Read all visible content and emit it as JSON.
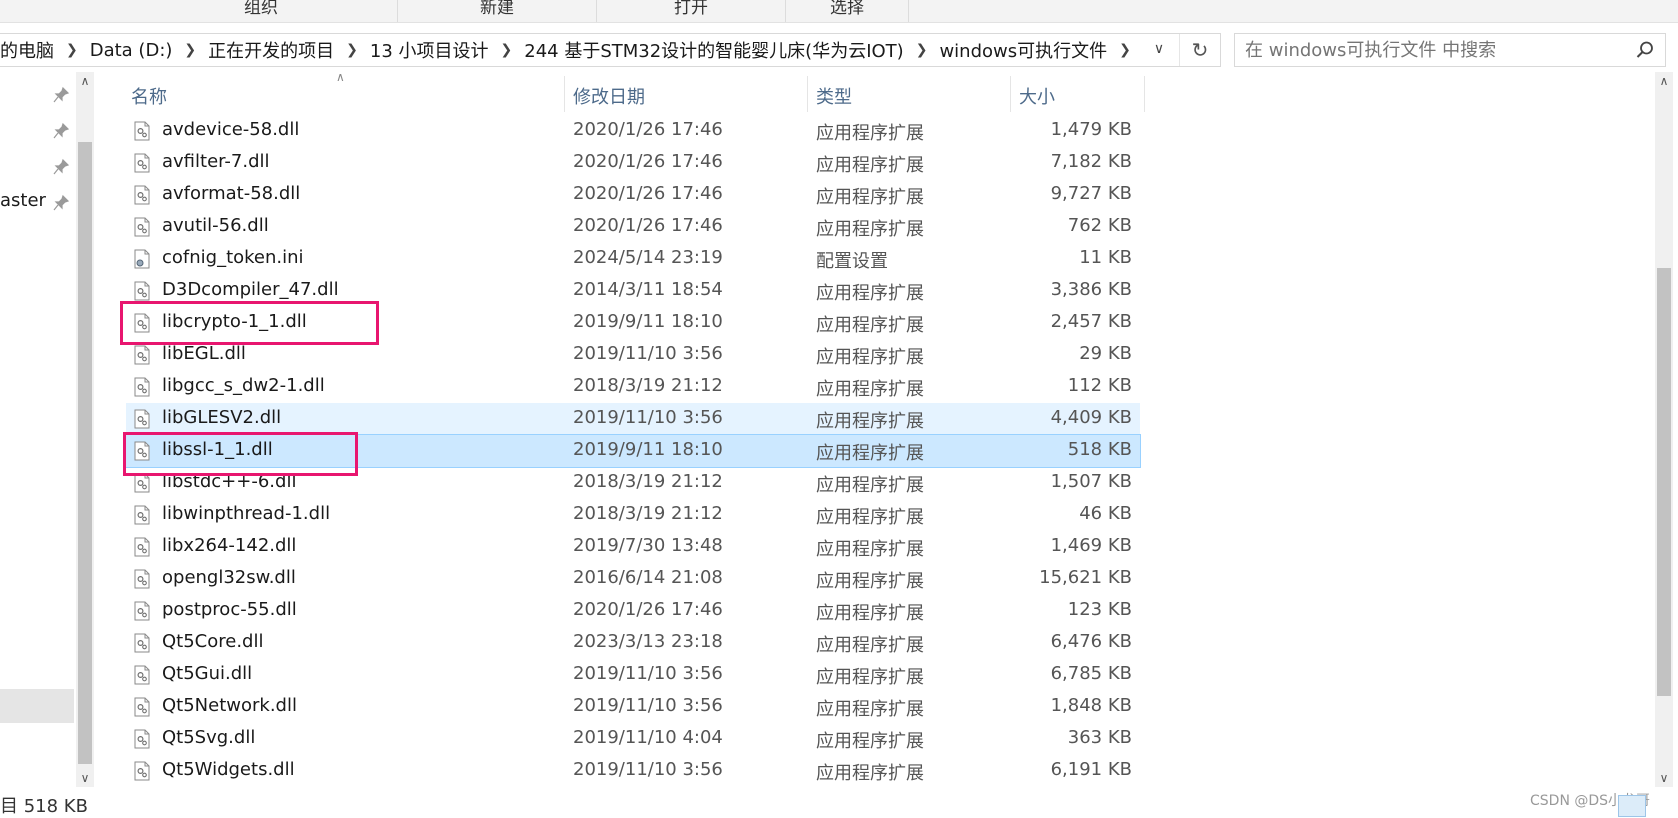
{
  "ribbon": {
    "groups": [
      "组织",
      "新建",
      "打开",
      "选择"
    ]
  },
  "address": {
    "crumbs": [
      "的电脑",
      "Data (D:)",
      "正在开发的项目",
      "13 小项目设计",
      "244 基于STM32设计的智能婴儿床(华为云IOT)",
      "windows可执行文件"
    ]
  },
  "search": {
    "placeholder": "在 windows可执行文件 中搜索"
  },
  "nav": {
    "partial_label": "aster"
  },
  "columns": {
    "name": "名称",
    "date": "修改日期",
    "type": "类型",
    "size": "大小"
  },
  "files": [
    {
      "name": "avdevice-58.dll",
      "date": "2020/1/26 17:46",
      "type": "应用程序扩展",
      "size": "1,479 KB"
    },
    {
      "name": "avfilter-7.dll",
      "date": "2020/1/26 17:46",
      "type": "应用程序扩展",
      "size": "7,182 KB"
    },
    {
      "name": "avformat-58.dll",
      "date": "2020/1/26 17:46",
      "type": "应用程序扩展",
      "size": "9,727 KB"
    },
    {
      "name": "avutil-56.dll",
      "date": "2020/1/26 17:46",
      "type": "应用程序扩展",
      "size": "762 KB"
    },
    {
      "name": "cofnig_token.ini",
      "date": "2024/5/14 23:19",
      "type": "配置设置",
      "size": "11 KB"
    },
    {
      "name": "D3Dcompiler_47.dll",
      "date": "2014/3/11 18:54",
      "type": "应用程序扩展",
      "size": "3,386 KB"
    },
    {
      "name": "libcrypto-1_1.dll",
      "date": "2019/9/11 18:10",
      "type": "应用程序扩展",
      "size": "2,457 KB"
    },
    {
      "name": "libEGL.dll",
      "date": "2019/11/10 3:56",
      "type": "应用程序扩展",
      "size": "29 KB"
    },
    {
      "name": "libgcc_s_dw2-1.dll",
      "date": "2018/3/19 21:12",
      "type": "应用程序扩展",
      "size": "112 KB"
    },
    {
      "name": "libGLESV2.dll",
      "date": "2019/11/10 3:56",
      "type": "应用程序扩展",
      "size": "4,409 KB"
    },
    {
      "name": "libssl-1_1.dll",
      "date": "2019/9/11 18:10",
      "type": "应用程序扩展",
      "size": "518 KB"
    },
    {
      "name": "libstdc++-6.dll",
      "date": "2018/3/19 21:12",
      "type": "应用程序扩展",
      "size": "1,507 KB"
    },
    {
      "name": "libwinpthread-1.dll",
      "date": "2018/3/19 21:12",
      "type": "应用程序扩展",
      "size": "46 KB"
    },
    {
      "name": "libx264-142.dll",
      "date": "2019/7/30 13:48",
      "type": "应用程序扩展",
      "size": "1,469 KB"
    },
    {
      "name": "opengl32sw.dll",
      "date": "2016/6/14 21:08",
      "type": "应用程序扩展",
      "size": "15,621 KB"
    },
    {
      "name": "postproc-55.dll",
      "date": "2020/1/26 17:46",
      "type": "应用程序扩展",
      "size": "123 KB"
    },
    {
      "name": "Qt5Core.dll",
      "date": "2023/3/13 23:18",
      "type": "应用程序扩展",
      "size": "6,476 KB"
    },
    {
      "name": "Qt5Gui.dll",
      "date": "2019/11/10 3:56",
      "type": "应用程序扩展",
      "size": "6,785 KB"
    },
    {
      "name": "Qt5Network.dll",
      "date": "2019/11/10 3:56",
      "type": "应用程序扩展",
      "size": "1,848 KB"
    },
    {
      "name": "Qt5Svg.dll",
      "date": "2019/11/10 4:04",
      "type": "应用程序扩展",
      "size": "363 KB"
    },
    {
      "name": "Qt5Widgets.dll",
      "date": "2019/11/10 3:56",
      "type": "应用程序扩展",
      "size": "6,191 KB"
    }
  ],
  "hover_index": 9,
  "selected_index": 10,
  "highlight_color": "#e8166f",
  "status": {
    "selected_size": "目 518 KB"
  },
  "watermark": "CSDN @DS小龙哥"
}
